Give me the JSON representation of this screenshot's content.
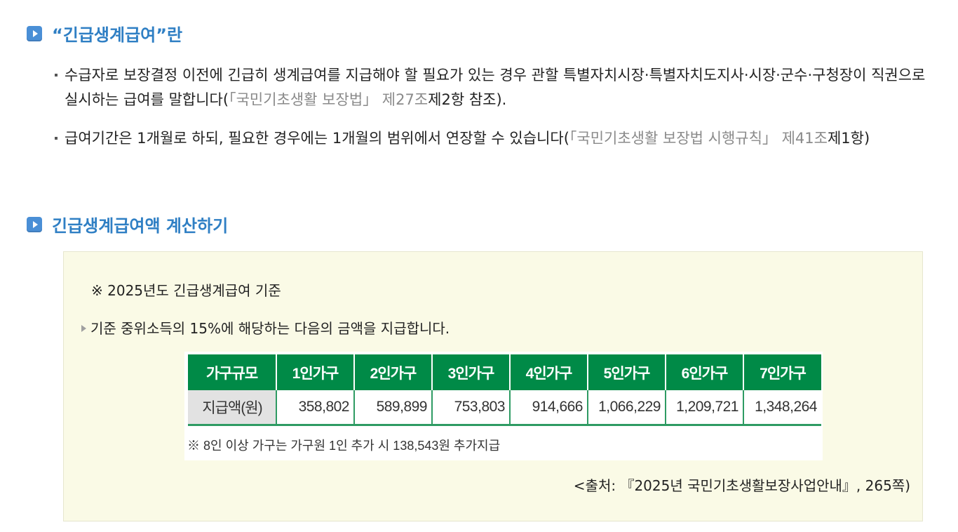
{
  "section1": {
    "heading": "“긴급생계급여”란",
    "items": [
      {
        "text_before": "수급자로 보장결정 이전에 긴급히 생계급여를 지급해야 할 필요가 있는 경우 관할 특별자치시장·특별자치도지사·시장·군수·구청장이 직권으로 실시하는 급여를 말합니다(",
        "ref": "「국민기초생활 보장법」 제27조",
        "text_after": "제2항 참조)."
      },
      {
        "text_before": "급여기간은 1개월로 하되, 필요한 경우에는 1개월의 범위에서 연장할 수 있습니다(",
        "ref": "「국민기초생활 보장법 시행규칙」 제41조",
        "text_after": "제1항)"
      }
    ]
  },
  "section2": {
    "heading": "긴급생계급여액 계산하기",
    "basis": "※ 2025년도 긴급생계급여 기준",
    "intro": "기준 중위소득의 15%에 해당하는 다음의 금액을 지급합니다.",
    "table": {
      "headers": [
        "가구규모",
        "1인가구",
        "2인가구",
        "3인가구",
        "4인가구",
        "5인가구",
        "6인가구",
        "7인가구"
      ],
      "row_label": "지급액(원)",
      "values": [
        "358,802",
        "589,899",
        "753,803",
        "914,666",
        "1,066,229",
        "1,209,721",
        "1,348,264"
      ],
      "note": "※ 8인 이상 가구는 가구원 1인 추가 시 138,543원 추가지급"
    },
    "source": "<출처: 『2025년 국민기초생활보장사업안내』, 265쪽)"
  },
  "colors": {
    "heading_blue": "#2f7fc4",
    "table_green": "#008a47",
    "box_background": "#fafae6",
    "reference_gray": "#8a8a8a"
  }
}
